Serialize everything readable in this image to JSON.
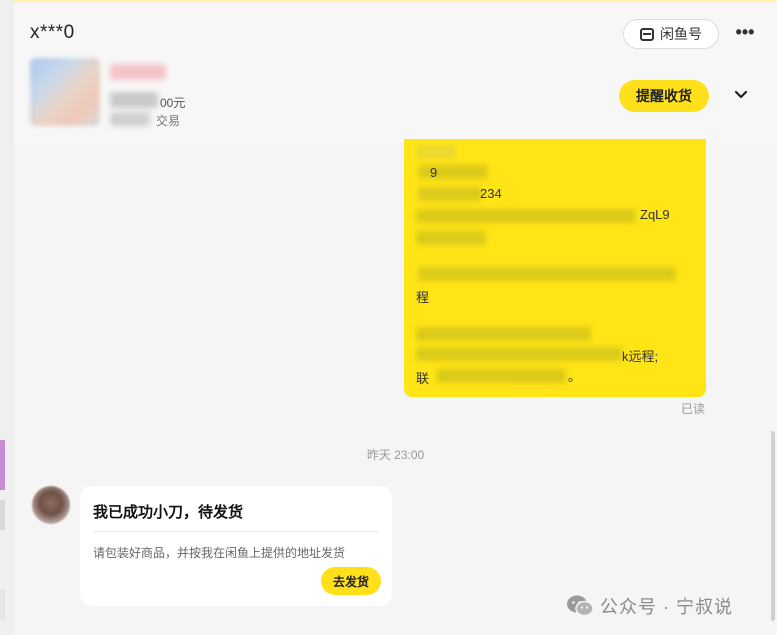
{
  "header": {
    "username": "x***0",
    "xianyu_button_label": "闲鱼号",
    "more_label": "•••",
    "product": {
      "price_suffix": "00元",
      "status_suffix": "交易"
    },
    "remind_button_label": "提醒收货"
  },
  "chat": {
    "outgoing_message": {
      "visible_fragments": [
        "9",
        "234",
        "ZqL9",
        "程",
        "k远程;",
        "联",
        "。"
      ],
      "read_status": "已读"
    },
    "timestamp": "昨天 23:00",
    "incoming_card": {
      "title": "我已成功小刀，待发货",
      "description": "请包装好商品，并按我在闲鱼上提供的地址发货",
      "button_label": "去发货"
    }
  },
  "watermark": {
    "text": "公众号 · 宁叔说"
  },
  "colors": {
    "accent_yellow": "#ffe01a",
    "bubble_yellow": "#ffe516",
    "background": "#f5f5f5"
  }
}
